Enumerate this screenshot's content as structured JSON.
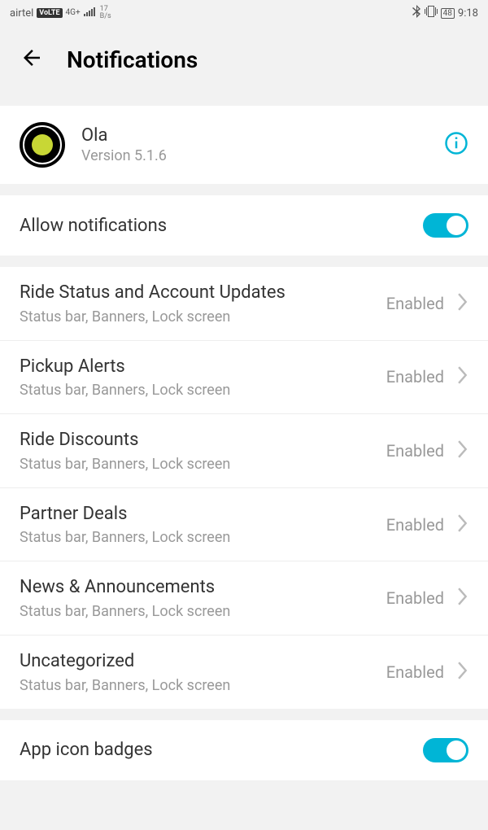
{
  "statusBar": {
    "carrier": "airtel",
    "volte": "VoLTE",
    "networkType": "4G+",
    "dataRate": "17",
    "dataUnit": "B/s",
    "battery": "48",
    "time": "9:18"
  },
  "header": {
    "title": "Notifications"
  },
  "app": {
    "name": "Ola",
    "version": "Version 5.1.6"
  },
  "allowNotifications": {
    "label": "Allow notifications"
  },
  "categories": [
    {
      "title": "Ride Status and Account Updates",
      "sub": "Status bar, Banners, Lock screen",
      "status": "Enabled"
    },
    {
      "title": "Pickup Alerts",
      "sub": "Status bar, Banners, Lock screen",
      "status": "Enabled"
    },
    {
      "title": "Ride Discounts",
      "sub": "Status bar, Banners, Lock screen",
      "status": "Enabled"
    },
    {
      "title": "Partner Deals",
      "sub": "Status bar, Banners, Lock screen",
      "status": "Enabled"
    },
    {
      "title": "News & Announcements",
      "sub": "Status bar, Banners, Lock screen",
      "status": "Enabled"
    },
    {
      "title": "Uncategorized",
      "sub": "Status bar, Banners, Lock screen",
      "status": "Enabled"
    }
  ],
  "appIconBadges": {
    "label": "App icon badges"
  }
}
